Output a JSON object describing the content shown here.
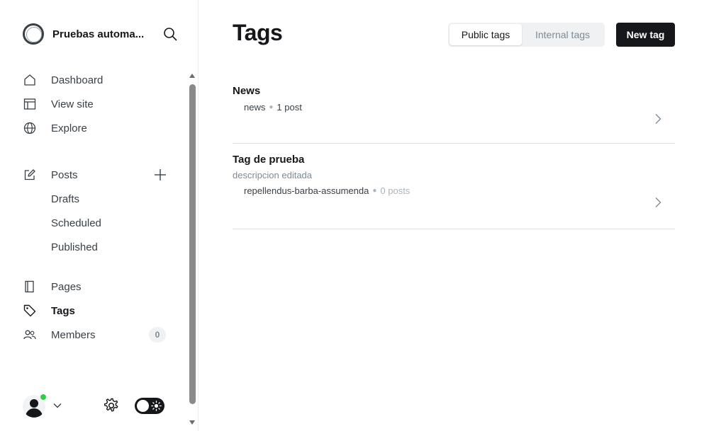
{
  "site": {
    "title": "Pruebas automa..."
  },
  "nav": {
    "dashboard": "Dashboard",
    "view_site": "View site",
    "explore": "Explore",
    "posts": "Posts",
    "drafts": "Drafts",
    "scheduled": "Scheduled",
    "published": "Published",
    "pages": "Pages",
    "tags": "Tags",
    "members": "Members",
    "members_count": "0"
  },
  "icons": {
    "search": "search-icon",
    "dashboard": "home-icon",
    "view_site": "layout-icon",
    "explore": "globe-icon",
    "posts": "edit-icon",
    "add_post": "plus-icon",
    "pages": "page-icon",
    "tags": "tag-icon",
    "members": "members-icon",
    "settings": "gear-icon",
    "theme": "sun-icon",
    "row": "chevron-right-icon"
  },
  "header": {
    "title": "Tags",
    "public_tab": "Public tags",
    "internal_tab": "Internal tags",
    "new_tag": "New tag"
  },
  "tags": [
    {
      "name": "News",
      "description": "",
      "slug": "news",
      "count": "1 post"
    },
    {
      "name": "Tag de prueba",
      "description": "descripcion editada",
      "slug": "repellendus-barba-assumenda",
      "count": "0 posts"
    }
  ],
  "colors": {
    "accent": "#15171a",
    "online": "#30cf43",
    "muted": "#7c8b9a",
    "divider": "#dde1e5"
  }
}
